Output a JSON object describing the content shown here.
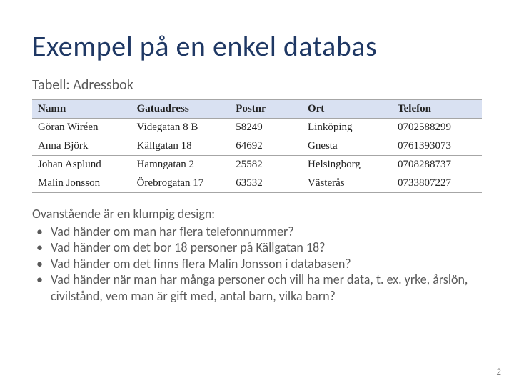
{
  "title": "Exempel på en enkel databas",
  "subtitle": "Tabell: Adressbok",
  "columns": [
    "Namn",
    "Gatuadress",
    "Postnr",
    "Ort",
    "Telefon"
  ],
  "rows": [
    {
      "namn": "Göran Wiréen",
      "gata": "Videgatan 8 B",
      "postnr": "58249",
      "ort": "Linköping",
      "tel": "0702588299"
    },
    {
      "namn": "Anna Björk",
      "gata": "Källgatan 18",
      "postnr": "64692",
      "ort": "Gnesta",
      "tel": "0761393073"
    },
    {
      "namn": "Johan Asplund",
      "gata": "Hamngatan 2",
      "postnr": "25582",
      "ort": "Helsingborg",
      "tel": "0708288737"
    },
    {
      "namn": "Malin Jonsson",
      "gata": "Örebrogatan 17",
      "postnr": "63532",
      "ort": "Västerås",
      "tel": "0733807227"
    }
  ],
  "notes_intro": "Ovanstående är en klumpig design:",
  "notes": [
    "Vad händer om man har flera telefonnummer?",
    "Vad händer om det bor 18 personer på Källgatan 18?",
    "Vad händer om det finns flera Malin Jonsson i databasen?",
    "Vad händer när man har många personer och vill ha mer data, t. ex. yrke, årslön, civilstånd, vem man är gift med, antal barn, vilka barn?"
  ],
  "page_number": "2",
  "chart_data": {
    "type": "table",
    "title": "Adressbok",
    "columns": [
      "Namn",
      "Gatuadress",
      "Postnr",
      "Ort",
      "Telefon"
    ],
    "rows": [
      [
        "Göran Wiréen",
        "Videgatan 8 B",
        "58249",
        "Linköping",
        "0702588299"
      ],
      [
        "Anna Björk",
        "Källgatan 18",
        "64692",
        "Gnesta",
        "0761393073"
      ],
      [
        "Johan Asplund",
        "Hamngatan 2",
        "25582",
        "Helsingborg",
        "0708288737"
      ],
      [
        "Malin Jonsson",
        "Örebrogatan 17",
        "63532",
        "Västerås",
        "0733807227"
      ]
    ]
  }
}
